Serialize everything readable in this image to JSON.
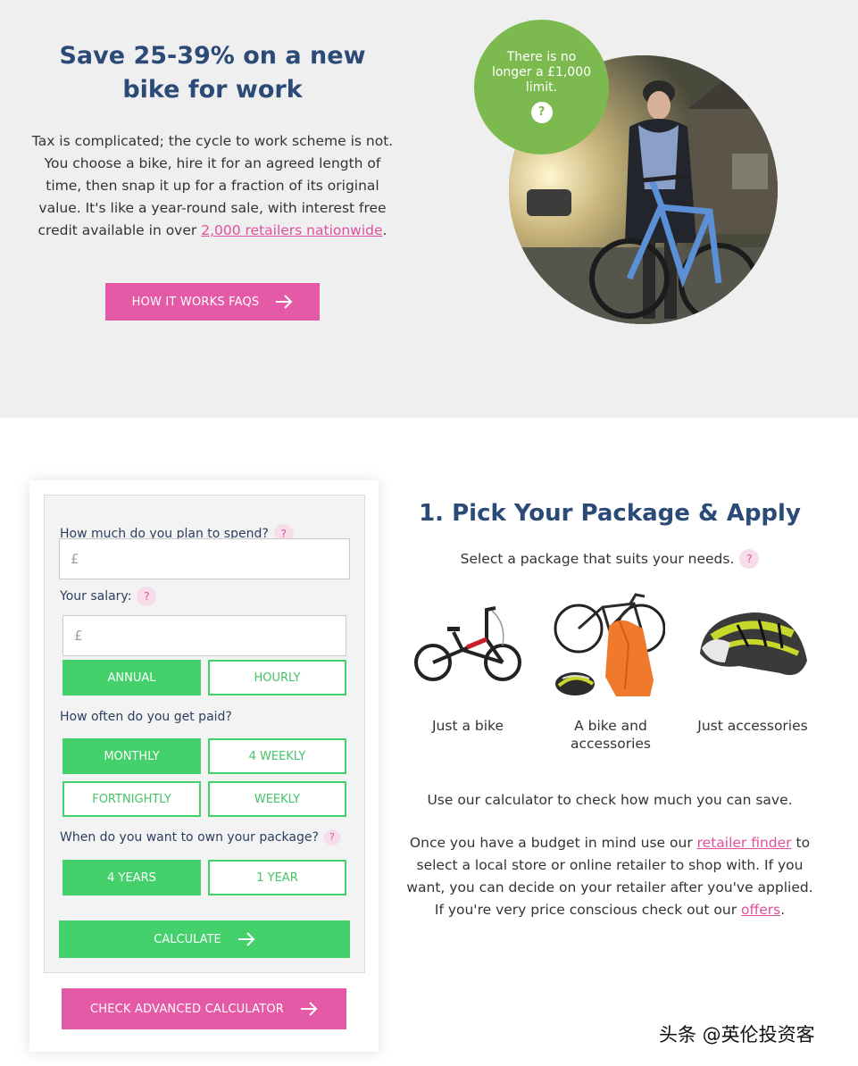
{
  "hero": {
    "title": "Save 25-39% on a new bike for work",
    "text": "Tax is complicated; the cycle to work scheme is not. You choose a bike, hire it for an agreed length of time, then snap it up for a fraction of its original value. It's like a year-round sale, with interest free credit available in over ",
    "link": "2,000 retailers nationwide",
    "text_end": ".",
    "button": "HOW IT WORKS FAQS",
    "bubble": "There is no longer a £1,000 limit.",
    "bubble_icon": "?"
  },
  "calculator": {
    "spend_label": "How much do you plan to spend?",
    "spend_placeholder": "£",
    "salary_label": "Your salary:",
    "salary_placeholder": "£",
    "salary_options": [
      "ANNUAL",
      "HOURLY"
    ],
    "paid_label": "How often do you get paid?",
    "paid_options": [
      "MONTHLY",
      "4 WEEKLY",
      "FORTNIGHTLY",
      "WEEKLY"
    ],
    "own_label": "When do you want to own your package?",
    "own_options": [
      "4 YEARS",
      "1 YEAR"
    ],
    "help_icon": "?",
    "calculate": "CALCULATE",
    "advanced": "CHECK ADVANCED CALCULATOR"
  },
  "step": {
    "title": "1. Pick Your Package & Apply",
    "subtitle": "Select a package that suits your needs.",
    "packages": [
      {
        "label": "Just a bike"
      },
      {
        "label": "A bike and accessories"
      },
      {
        "label": "Just accessories"
      }
    ],
    "para1": "Use our calculator to check how much you can save.",
    "para2_start": "Once you have a budget in mind use our ",
    "para2_link": "retailer finder",
    "para2_mid": " to select a local store or online retailer to shop with. If you want, you can decide on your retailer after you've applied. If you're very price conscious check out our ",
    "para2_link2": "offers",
    "para2_end": "."
  },
  "watermark": "头条 @英伦投资客",
  "colors": {
    "navy": "#2b4a78",
    "pink": "#e55aa6",
    "green": "#44d06a",
    "bubble_green": "#7cba4f"
  }
}
